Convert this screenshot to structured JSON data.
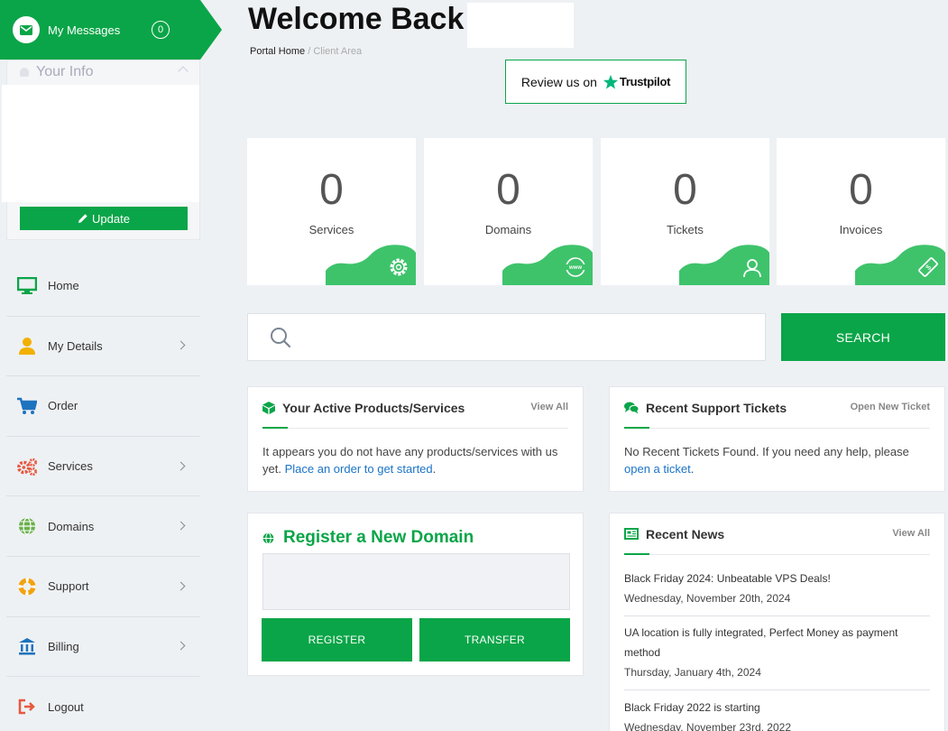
{
  "messages": {
    "label": "My Messages",
    "count": "0"
  },
  "info": {
    "title": "Your Info",
    "update_label": "Update"
  },
  "nav": [
    {
      "label": "Home",
      "icon": "monitor-icon",
      "chevron": false
    },
    {
      "label": "My Details",
      "icon": "user-icon",
      "chevron": true
    },
    {
      "label": "Order",
      "icon": "cart-icon",
      "chevron": false
    },
    {
      "label": "Services",
      "icon": "cogs-icon",
      "chevron": true
    },
    {
      "label": "Domains",
      "icon": "globe-icon",
      "chevron": true
    },
    {
      "label": "Support",
      "icon": "lifebuoy-icon",
      "chevron": true
    },
    {
      "label": "Billing",
      "icon": "bank-icon",
      "chevron": true
    },
    {
      "label": "Logout",
      "icon": "logout-icon",
      "chevron": false
    }
  ],
  "header": {
    "welcome": "Welcome Back",
    "crumb_home": "Portal Home",
    "crumb_sep": "/",
    "crumb_current": "Client Area",
    "review_text": "Review us on",
    "trustpilot": "Trustpilot"
  },
  "tiles": [
    {
      "count": "0",
      "label": "Services",
      "icon": "gear-icon"
    },
    {
      "count": "0",
      "label": "Domains",
      "icon": "www-icon"
    },
    {
      "count": "0",
      "label": "Tickets",
      "icon": "user-icon"
    },
    {
      "count": "0",
      "label": "Invoices",
      "icon": "ticket-icon"
    }
  ],
  "search": {
    "placeholder": "",
    "button": "SEARCH"
  },
  "products": {
    "title": "Your Active Products/Services",
    "link": "View All",
    "text": "It appears you do not have any products/services with us yet.",
    "cta": "Place an order to get started",
    "cta_end": "."
  },
  "tickets": {
    "title": "Recent Support Tickets",
    "link": "Open New Ticket",
    "text": "No Recent Tickets Found. If you need any help, please",
    "cta": "open a ticket",
    "cta_end": "."
  },
  "domain": {
    "title": "Register a New Domain",
    "register": "REGISTER",
    "transfer": "TRANSFER"
  },
  "news": {
    "title": "Recent News",
    "link": "View All",
    "items": [
      {
        "title": "Black Friday 2024: Unbeatable VPS Deals!",
        "date": "Wednesday, November 20th, 2024"
      },
      {
        "title": "UA location is fully integrated, Perfect Money as payment method",
        "date": "Thursday, January 4th, 2024"
      },
      {
        "title": "Black Friday 2022 is starting",
        "date": "Wednesday, November 23rd, 2022"
      }
    ]
  },
  "colors": {
    "accent": "#0aa548",
    "link": "#1a73c8",
    "background": "#eef1f4"
  }
}
